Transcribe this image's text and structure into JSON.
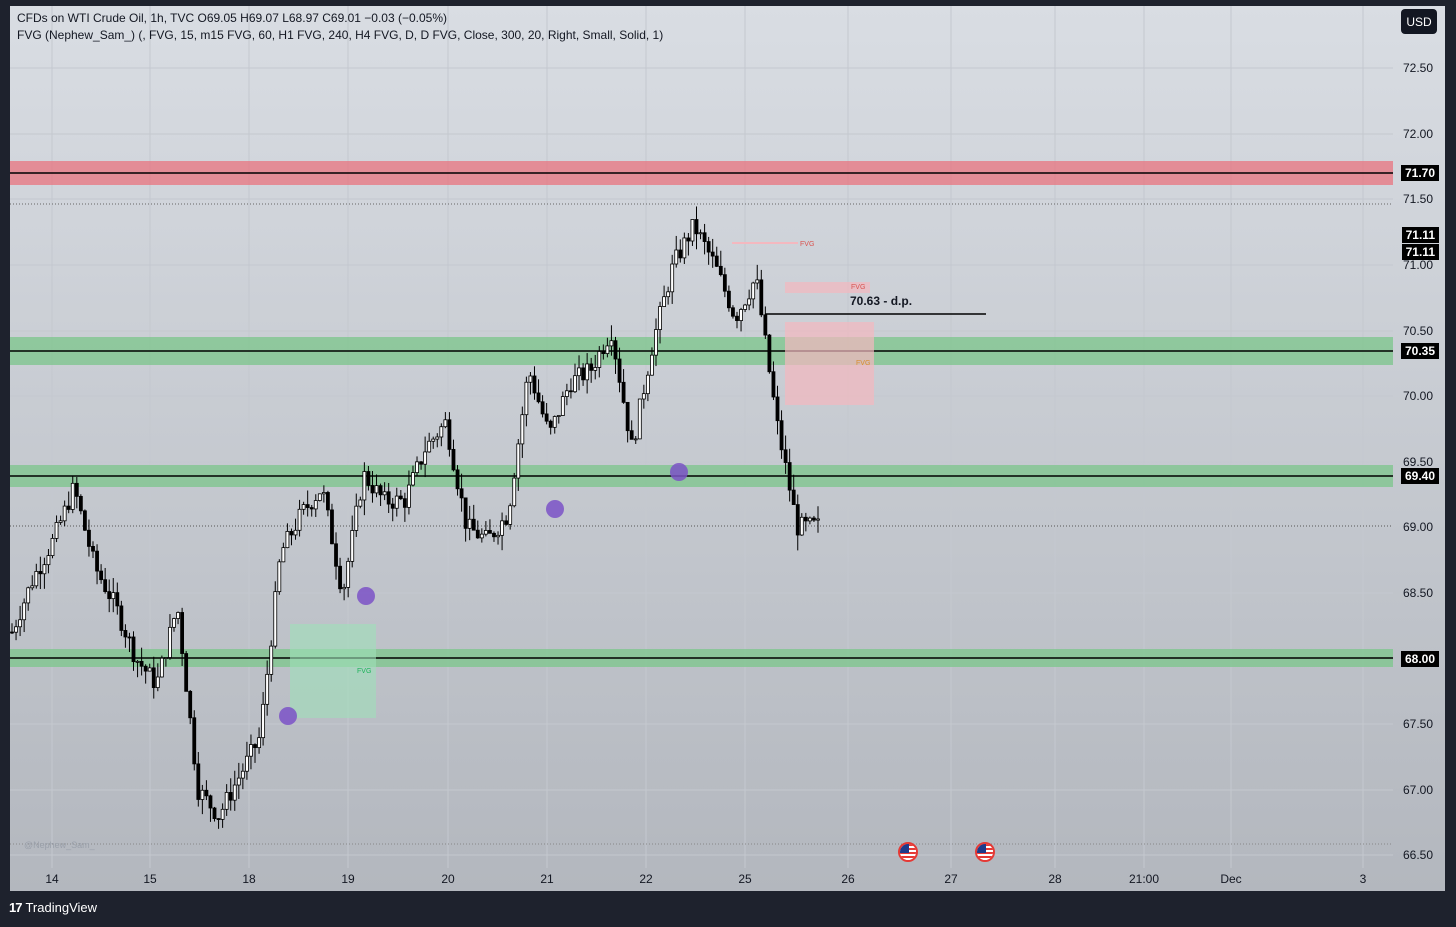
{
  "legend": {
    "line1": "CFDs on WTI Crude Oil, 1h, TVC  O69.05  H69.07  L68.97  C69.01  −0.03 (−0.05%)",
    "line2": "FVG (Nephew_Sam_) (, FVG, 15, m15 FVG, 60, H1 FVG, 240, H4 FVG, D, D FVG, Close, 300, 20, Right, Small, Solid, 1)"
  },
  "currency_button": "USD",
  "price_axis": {
    "ticks": [
      "72.50",
      "72.00",
      "71.50",
      "71.00",
      "70.50",
      "70.00",
      "69.50",
      "69.00",
      "68.50",
      "67.50",
      "67.00",
      "66.50"
    ],
    "badges": [
      "71.70",
      "71.11",
      "71.11",
      "70.35",
      "69.40",
      "68.00"
    ]
  },
  "time_axis": {
    "ticks": [
      "14",
      "15",
      "18",
      "19",
      "20",
      "21",
      "22",
      "25",
      "26",
      "27",
      "28",
      "21:00",
      "Dec",
      "3"
    ]
  },
  "annotations": {
    "dp_label": "70.63 - d.p.",
    "fvg_label": "FVG",
    "watermark": "@Nephew_Sam_"
  },
  "levels": {
    "resistance_zone": "71.70",
    "support_zones": [
      "70.35",
      "69.40",
      "68.00"
    ],
    "draw_line": "70.63"
  },
  "chart_data": {
    "type": "candlestick",
    "symbol": "CFDs on WTI Crude Oil",
    "interval": "1h",
    "last": {
      "open": 69.05,
      "high": 69.07,
      "low": 68.97,
      "close": 69.01,
      "change": -0.03,
      "change_pct": -0.05
    },
    "ylim": [
      66.5,
      72.5
    ],
    "approx_path": [
      [
        "14",
        68.2
      ],
      [
        "14",
        68.6
      ],
      [
        "14",
        68.9
      ],
      [
        "14",
        69.3
      ],
      [
        "15",
        68.7
      ],
      [
        "15",
        68.4
      ],
      [
        "15",
        68.0
      ],
      [
        "15",
        67.8
      ],
      [
        "15",
        68.4
      ],
      [
        "18",
        67.0
      ],
      [
        "18",
        66.8
      ],
      [
        "18",
        67.1
      ],
      [
        "18",
        67.4
      ],
      [
        "18",
        68.8
      ],
      [
        "19",
        69.1
      ],
      [
        "19",
        69.3
      ],
      [
        "19",
        68.5
      ],
      [
        "19",
        69.4
      ],
      [
        "19",
        69.2
      ],
      [
        "20",
        69.2
      ],
      [
        "20",
        69.6
      ],
      [
        "20",
        69.8
      ],
      [
        "20",
        69.0
      ],
      [
        "21",
        68.9
      ],
      [
        "21",
        69.1
      ],
      [
        "21",
        70.2
      ],
      [
        "21",
        69.7
      ],
      [
        "21",
        70.1
      ],
      [
        "22",
        70.2
      ],
      [
        "22",
        70.5
      ],
      [
        "22",
        69.6
      ],
      [
        "22",
        70.4
      ],
      [
        "22",
        71.0
      ],
      [
        "22",
        71.3
      ],
      [
        "25",
        71.0
      ],
      [
        "25",
        70.6
      ],
      [
        "25",
        70.9
      ],
      [
        "25",
        69.8
      ],
      [
        "25",
        69.0
      ],
      [
        "25",
        69.01
      ]
    ],
    "swing_markers": [
      67.6,
      68.5,
      69.2,
      69.4
    ],
    "zones": [
      {
        "kind": "resistance",
        "price": 71.7
      },
      {
        "kind": "support",
        "price": 70.35
      },
      {
        "kind": "support",
        "price": 69.4
      },
      {
        "kind": "support",
        "price": 68.0
      }
    ]
  },
  "colors": {
    "red_zone": "#e8737f",
    "green_zone": "#7fc58e",
    "marker": "#7b52c7",
    "candle": "#000000",
    "fvg_red": "#f4b8bf",
    "fvg_green": "#9fe0b9"
  },
  "brand": "TradingView"
}
